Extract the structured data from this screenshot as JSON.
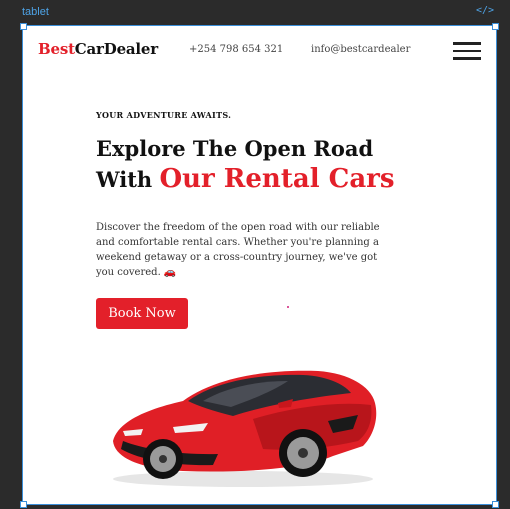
{
  "editor": {
    "frame_label": "tablet",
    "code_icon": "</>"
  },
  "header": {
    "brand_accent": "Best",
    "brand_rest": "CarDealer",
    "phone": "+254 798 654 321",
    "email": "info@bestcardealer",
    "menu_icon": "hamburger-menu-icon"
  },
  "hero": {
    "tagline": "YOUR ADVENTURE AWAITS.",
    "headline_line1": "Explore The Open Road",
    "headline_line2_prefix": "With",
    "headline_line2_highlight": "Our Rental Cars",
    "description": "Discover the freedom of the open road with our reliable and comfortable rental cars. Whether you're planning a weekend getaway or a cross-country journey, we've got you covered. 🚗",
    "cta_label": "Book Now",
    "image": "red-sports-car"
  },
  "colors": {
    "accent": "#e3202a",
    "editor_blue": "#3b8fd9",
    "editor_bg": "#2b2b2b"
  }
}
